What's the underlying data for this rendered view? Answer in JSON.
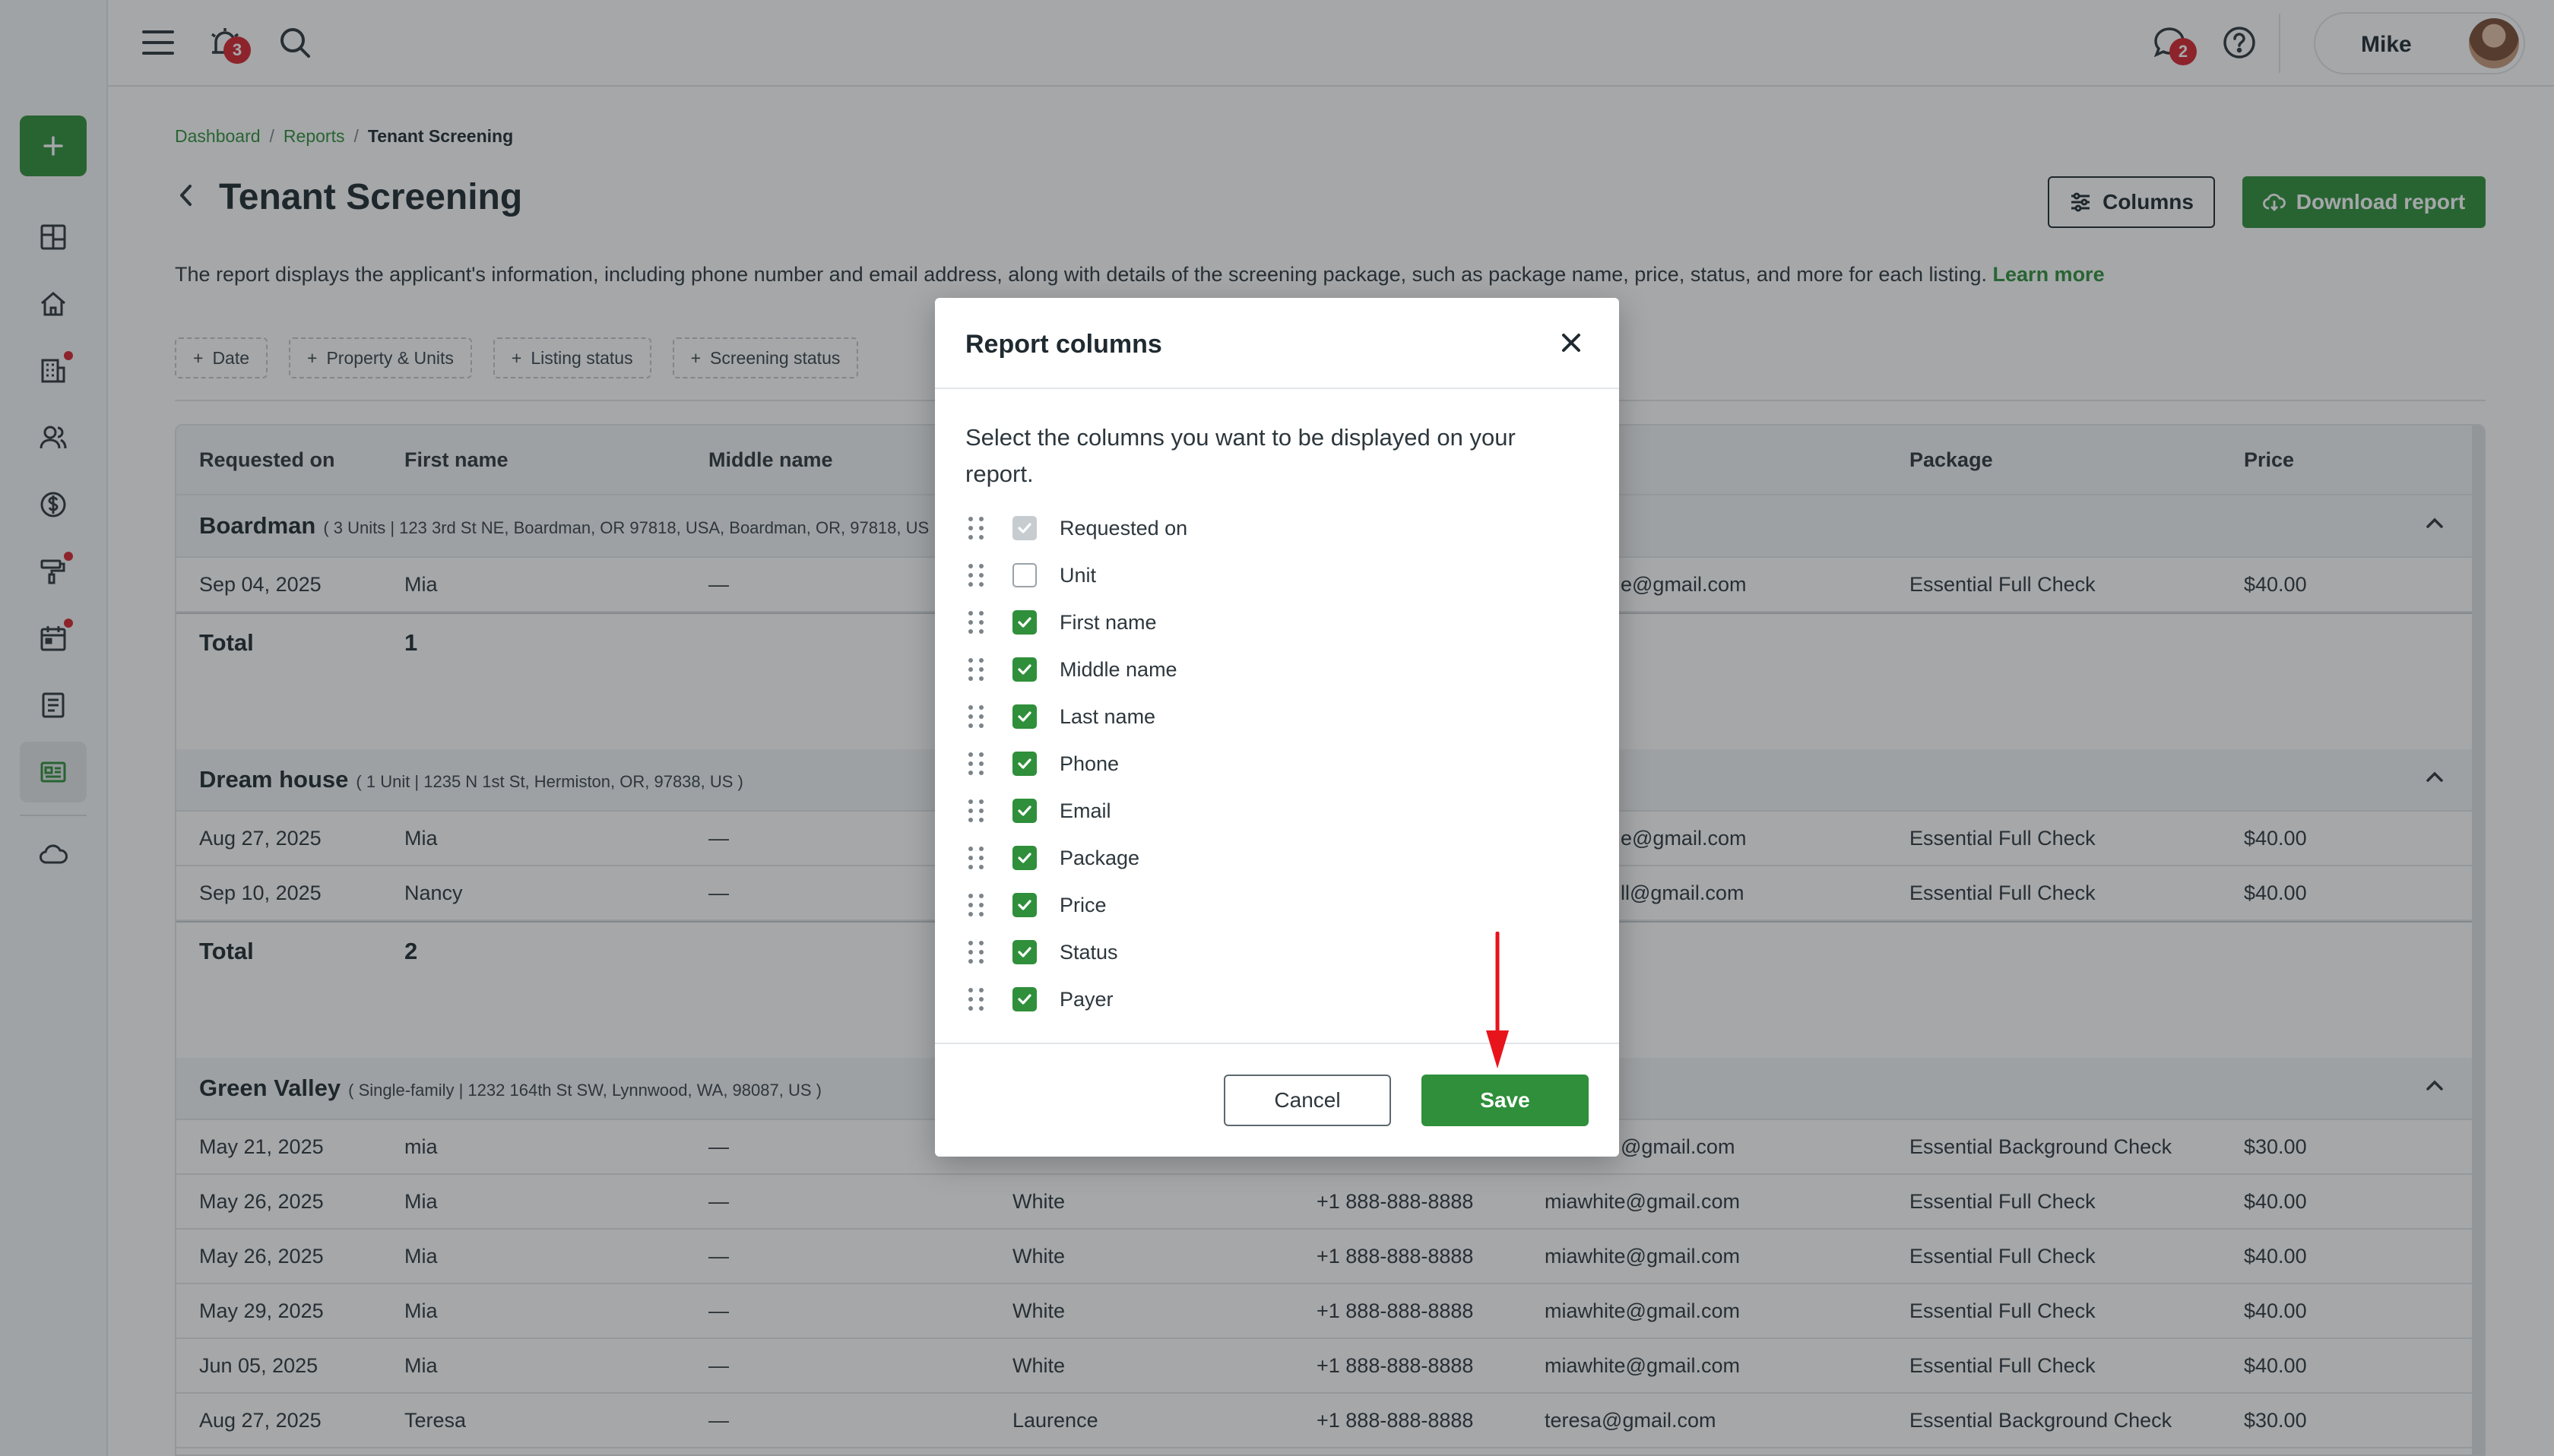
{
  "topbar": {
    "notifications_count": "3",
    "messages_count": "2",
    "user_name": "Mike"
  },
  "breadcrumb": {
    "items": [
      "Dashboard",
      "Reports"
    ],
    "current": "Tenant Screening",
    "separator": "/"
  },
  "page": {
    "title": "Tenant Screening",
    "columns_button": "Columns",
    "download_button": "Download report",
    "description": "The report displays the applicant's information, including phone number and email address, along with details of the screening package, such as package name, price, status, and more for each listing.",
    "learn_more": "Learn more"
  },
  "filters": [
    "Date",
    "Property & Units",
    "Listing status",
    "Screening status"
  ],
  "table": {
    "headers": [
      "Requested on",
      "First name",
      "Middle name",
      "Package",
      "Price"
    ],
    "groups": [
      {
        "name": "Boardman",
        "detail": "( 3 Units | 123 3rd St NE, Boardman, OR 97818, USA, Boardman, OR, 97818, US",
        "rows": [
          {
            "requested": "Sep 04, 2025",
            "first": "Mia",
            "middle": "—",
            "email": "e@gmail.com",
            "package": "Essential Full Check",
            "price": "$40.00"
          }
        ],
        "total_label": "Total",
        "total_value": "1"
      },
      {
        "name": "Dream house",
        "detail": "( 1 Unit | 1235 N 1st St, Hermiston, OR, 97838, US )",
        "rows": [
          {
            "requested": "Aug 27, 2025",
            "first": "Mia",
            "middle": "—",
            "email": "e@gmail.com",
            "package": "Essential Full Check",
            "price": "$40.00"
          },
          {
            "requested": "Sep 10, 2025",
            "first": "Nancy",
            "middle": "—",
            "email": "ll@gmail.com",
            "package": "Essential Full Check",
            "price": "$40.00"
          }
        ],
        "total_label": "Total",
        "total_value": "2"
      },
      {
        "name": "Green Valley",
        "detail": "( Single-family | 1232 164th St SW, Lynnwood, WA, 98087, US )",
        "rows": [
          {
            "requested": "May 21, 2025",
            "first": "mia",
            "middle": "—",
            "last": "",
            "phone": "",
            "email": "@gmail.com",
            "package": "Essential Background Check",
            "price": "$30.00"
          },
          {
            "requested": "May 26, 2025",
            "first": "Mia",
            "middle": "—",
            "last": "White",
            "phone": "+1 888-888-8888",
            "email": "miawhite@gmail.com",
            "package": "Essential Full Check",
            "price": "$40.00"
          },
          {
            "requested": "May 26, 2025",
            "first": "Mia",
            "middle": "—",
            "last": "White",
            "phone": "+1 888-888-8888",
            "email": "miawhite@gmail.com",
            "package": "Essential Full Check",
            "price": "$40.00"
          },
          {
            "requested": "May 29, 2025",
            "first": "Mia",
            "middle": "—",
            "last": "White",
            "phone": "+1 888-888-8888",
            "email": "miawhite@gmail.com",
            "package": "Essential Full Check",
            "price": "$40.00"
          },
          {
            "requested": "Jun 05, 2025",
            "first": "Mia",
            "middle": "—",
            "last": "White",
            "phone": "+1 888-888-8888",
            "email": "miawhite@gmail.com",
            "package": "Essential Full Check",
            "price": "$40.00"
          },
          {
            "requested": "Aug 27, 2025",
            "first": "Teresa",
            "middle": "—",
            "last": "Laurence",
            "phone": "+1 888-888-8888",
            "email": "teresa@gmail.com",
            "package": "Essential Background Check",
            "price": "$30.00"
          }
        ]
      }
    ]
  },
  "modal": {
    "title": "Report columns",
    "intro": "Select the columns you want to be displayed on your report.",
    "columns": [
      {
        "label": "Requested on",
        "state": "disabled"
      },
      {
        "label": "Unit",
        "state": "off"
      },
      {
        "label": "First name",
        "state": "on"
      },
      {
        "label": "Middle name",
        "state": "on"
      },
      {
        "label": "Last name",
        "state": "on"
      },
      {
        "label": "Phone",
        "state": "on"
      },
      {
        "label": "Email",
        "state": "on"
      },
      {
        "label": "Package",
        "state": "on"
      },
      {
        "label": "Price",
        "state": "on"
      },
      {
        "label": "Status",
        "state": "on"
      },
      {
        "label": "Payer",
        "state": "on"
      }
    ],
    "cancel_label": "Cancel",
    "save_label": "Save"
  },
  "colors": {
    "brand_green": "#2f8f3a",
    "badge_red": "#d8262d",
    "arrow_red": "#e8141c"
  }
}
